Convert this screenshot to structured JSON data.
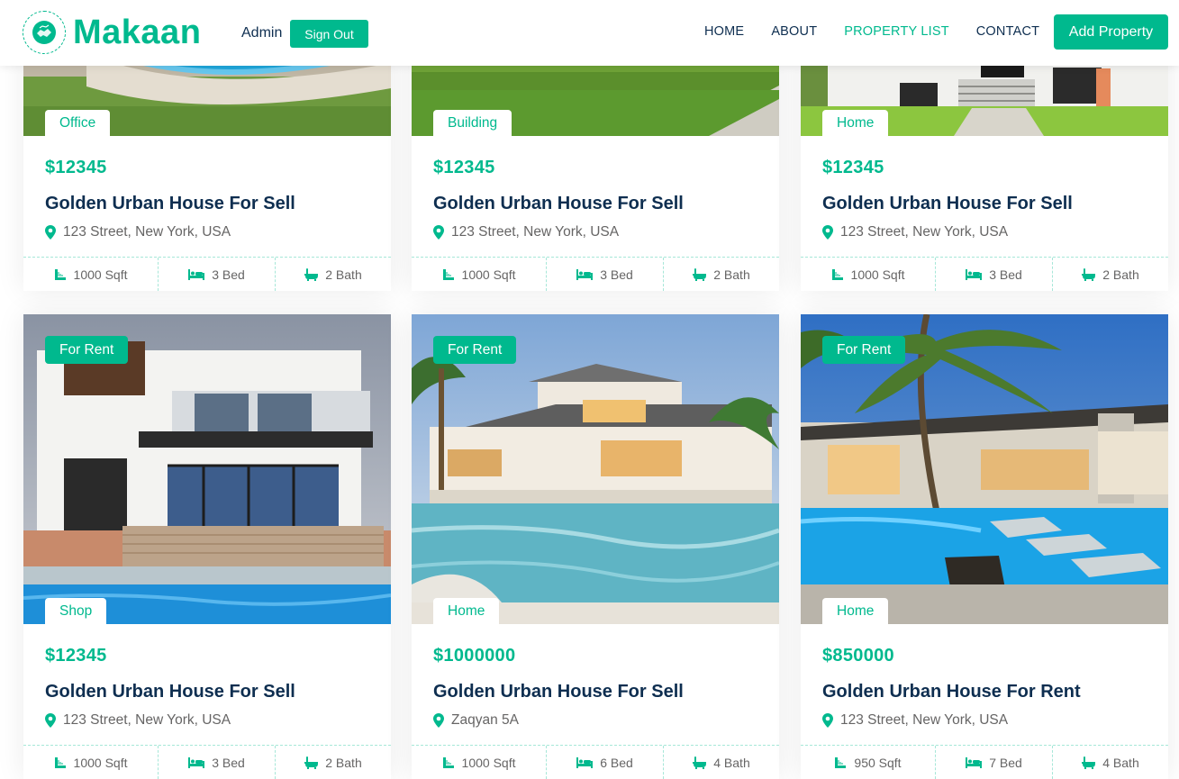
{
  "nav": {
    "brand": "Makaan",
    "admin": "Admin",
    "sign_out": "Sign Out",
    "links": [
      "HOME",
      "ABOUT",
      "PROPERTY LIST",
      "CONTACT"
    ],
    "active": "PROPERTY LIST",
    "add_property": "Add Property"
  },
  "colors": {
    "accent": "#00b98e",
    "dark": "#0e2e50",
    "muted": "#666565"
  },
  "properties": [
    {
      "type": "Office",
      "status": "",
      "price": "$12345",
      "title": "Golden Urban House For Sell",
      "address": "123 Street, New York, USA",
      "sqft": "1000 Sqft",
      "bed": "3 Bed",
      "bath": "2 Bath"
    },
    {
      "type": "Building",
      "status": "",
      "price": "$12345",
      "title": "Golden Urban House For Sell",
      "address": "123 Street, New York, USA",
      "sqft": "1000 Sqft",
      "bed": "3 Bed",
      "bath": "2 Bath"
    },
    {
      "type": "Home",
      "status": "",
      "price": "$12345",
      "title": "Golden Urban House For Sell",
      "address": "123 Street, New York, USA",
      "sqft": "1000 Sqft",
      "bed": "3 Bed",
      "bath": "2 Bath"
    },
    {
      "type": "Shop",
      "status": "For Rent",
      "price": "$12345",
      "title": "Golden Urban House For Sell",
      "address": "123 Street, New York, USA",
      "sqft": "1000 Sqft",
      "bed": "3 Bed",
      "bath": "2 Bath"
    },
    {
      "type": "Home",
      "status": "For Rent",
      "price": "$1000000",
      "title": "Golden Urban House For Sell",
      "address": "Zaqyan 5A",
      "sqft": "1000 Sqft",
      "bed": "6 Bed",
      "bath": "4 Bath"
    },
    {
      "type": "Home",
      "status": "For Rent",
      "price": "$850000",
      "title": "Golden Urban House For Rent",
      "address": "123 Street, New York, USA",
      "sqft": "950 Sqft",
      "bed": "7 Bed",
      "bath": "4 Bath"
    }
  ]
}
